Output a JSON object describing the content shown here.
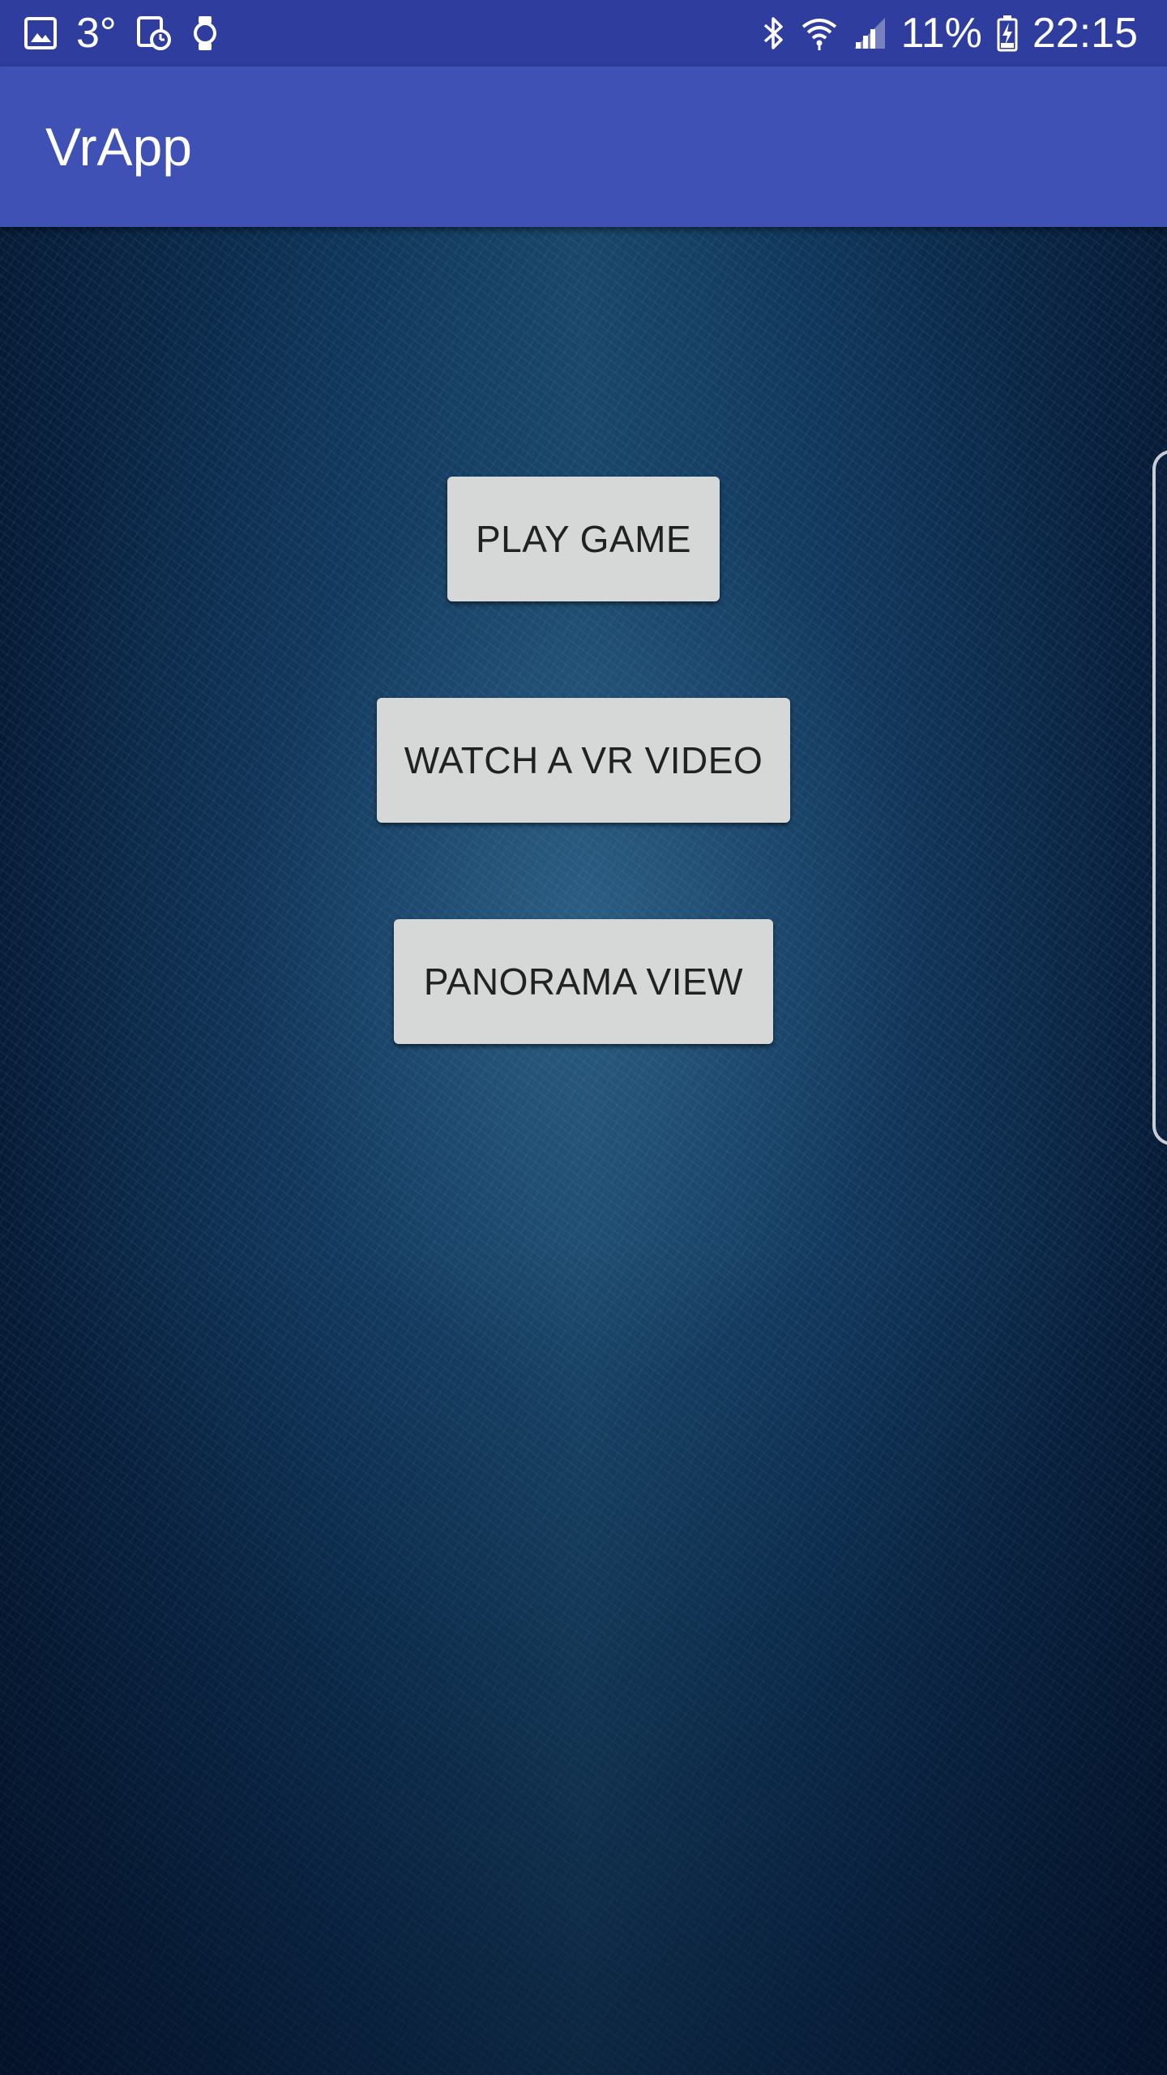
{
  "status_bar": {
    "temperature": "3°",
    "battery": "11%",
    "time": "22:15",
    "left_icons": [
      "image-icon",
      "calendar-clock-icon",
      "watch-icon"
    ],
    "right_icons": [
      "bluetooth-icon",
      "wifi-icon",
      "signal-icon",
      "battery-charging-icon"
    ],
    "background_color": "#2f3e9e"
  },
  "app_bar": {
    "title": "VrApp",
    "background_color": "#3f51b5"
  },
  "main": {
    "buttons": [
      {
        "id": "play",
        "label": "PLAY GAME"
      },
      {
        "id": "video",
        "label": "WATCH A VR VIDEO"
      },
      {
        "id": "panorama",
        "label": "PANORAMA VIEW"
      }
    ],
    "button_color": "#d6d7d7",
    "background_color": "#0e3458"
  }
}
